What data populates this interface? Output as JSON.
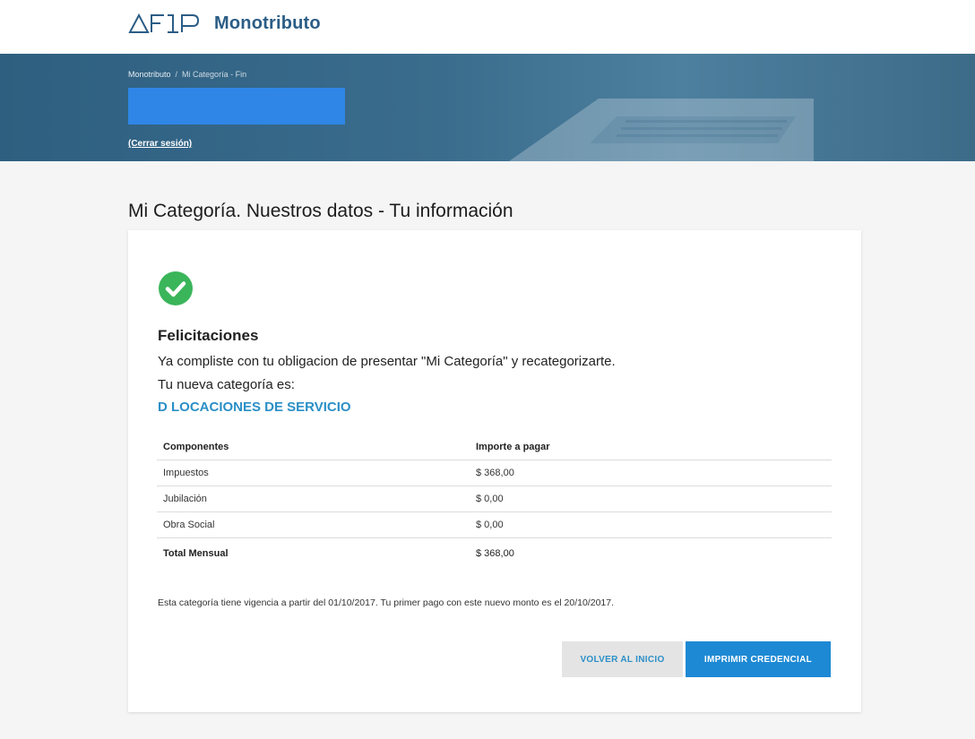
{
  "header": {
    "brand": "Monotributo",
    "logo_icon": "afip-logo-icon"
  },
  "hero": {
    "breadcrumb": {
      "root": "Monotributo",
      "separator": "/",
      "current": "Mi Categoría - Fin"
    },
    "logout_label": "(Cerrar sesión)"
  },
  "page": {
    "title": "Mi Categoría. Nuestros datos - Tu información"
  },
  "card": {
    "status_icon": "check-circle-icon",
    "heading": "Felicitaciones",
    "message_line1": "Ya compliste con tu obligacion de presentar \"Mi Categoría\" y recategorizarte.",
    "message_line2": "Tu nueva categoría es:",
    "category": "D LOCACIONES DE SERVICIO",
    "table": {
      "headers": [
        "Componentes",
        "Importe a pagar"
      ],
      "rows": [
        {
          "component": "Impuestos",
          "amount": "$ 368,00"
        },
        {
          "component": "Jubilación",
          "amount": "$ 0,00"
        },
        {
          "component": "Obra Social",
          "amount": "$ 0,00"
        }
      ],
      "total": {
        "component": "Total Mensual",
        "amount": "$ 368,00"
      }
    },
    "validity_note": "Esta categoría tiene vigencia a partir del 01/10/2017. Tu primer pago con este nuevo monto es el 20/10/2017.",
    "buttons": {
      "back_label": "VOLVER AL INICIO",
      "print_label": "IMPRIMIR CREDENCIAL"
    }
  },
  "colors": {
    "brand_blue": "#2b5d86",
    "hero_bg": "#3a6c8d",
    "accent": "#2b8fc7",
    "success_green": "#3ab55a",
    "primary_button": "#1d89d4"
  }
}
